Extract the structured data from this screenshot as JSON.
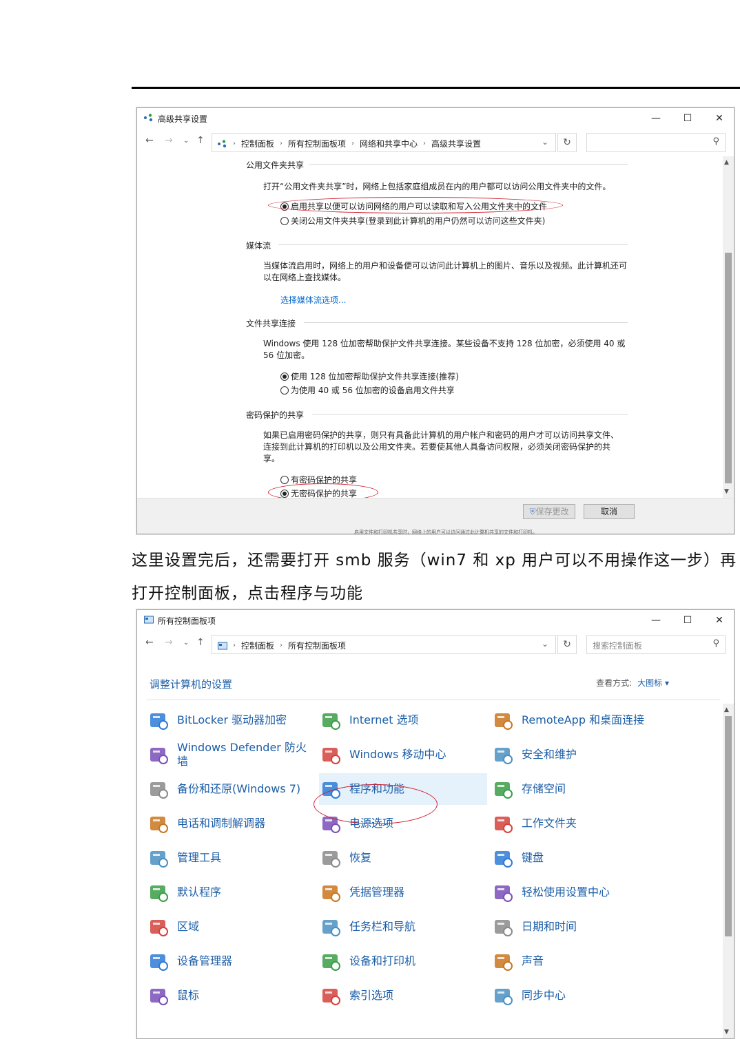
{
  "window1": {
    "title": "高级共享设置",
    "breadcrumbs": [
      "控制面板",
      "所有控制面板项",
      "网络和共享中心",
      "高级共享设置"
    ],
    "sections": {
      "public_folder": {
        "heading": "公用文件夹共享",
        "desc": "打开“公用文件夹共享”时，网络上包括家庭组成员在内的用户都可以访问公用文件夹中的文件。",
        "opt_on": "启用共享以便可以访问网络的用户可以读取和写入公用文件夹中的文件",
        "opt_off": "关闭公用文件夹共享(登录到此计算机的用户仍然可以访问这些文件夹)"
      },
      "media": {
        "heading": "媒体流",
        "desc": "当媒体流启用时，网络上的用户和设备便可以访问此计算机上的图片、音乐以及视频。此计算机还可以在网络上查找媒体。",
        "link": "选择媒体流选项..."
      },
      "file_sharing": {
        "heading": "文件共享连接",
        "desc": "Windows 使用 128 位加密帮助保护文件共享连接。某些设备不支持 128 位加密，必须使用 40 或 56 位加密。",
        "opt_128": "使用 128 位加密帮助保护文件共享连接(推荐)",
        "opt_40": "为使用 40 或 56 位加密的设备启用文件共享"
      },
      "password": {
        "heading": "密码保护的共享",
        "desc": "如果已启用密码保护的共享，则只有具备此计算机的用户帐户和密码的用户才可以访问共享文件、连接到此计算机的打印机以及公用文件夹。若要使其他人具备访问权限，必须关闭密码保护的共享。",
        "opt_on": "有密码保护的共享",
        "opt_off": "无密码保护的共享"
      }
    },
    "save_label": "保存更改",
    "cancel_label": "取消",
    "below_caption": "启用文件和打印机共享时，网络上的用户可以访问通过此计算机共享的文件和打印机。"
  },
  "body_text": {
    "line1": "这里设置完后，还需要打开 smb 服务（win7 和 xp 用户可以不用操作这一步）再",
    "line2": "打开控制面板，点击程序与功能"
  },
  "window2": {
    "title": "所有控制面板项",
    "breadcrumbs": [
      "控制面板",
      "所有控制面板项"
    ],
    "search_placeholder": "搜索控制面板",
    "heading": "调整计算机的设置",
    "view_label": "查看方式:",
    "view_value": "大图标 ▾",
    "items": [
      {
        "label": "BitLocker 驱动器加密",
        "icon": "bitlocker-icon"
      },
      {
        "label": "Internet 选项",
        "icon": "internet-options-icon"
      },
      {
        "label": "RemoteApp 和桌面连接",
        "icon": "remoteapp-icon"
      },
      {
        "label": "Windows Defender 防火墙",
        "icon": "firewall-icon"
      },
      {
        "label": "Windows 移动中心",
        "icon": "mobility-center-icon"
      },
      {
        "label": "安全和维护",
        "icon": "security-maintenance-icon"
      },
      {
        "label": "备份和还原(Windows 7)",
        "icon": "backup-restore-icon"
      },
      {
        "label": "程序和功能",
        "icon": "programs-features-icon"
      },
      {
        "label": "存储空间",
        "icon": "storage-spaces-icon"
      },
      {
        "label": "电话和调制解调器",
        "icon": "phone-modem-icon"
      },
      {
        "label": "电源选项",
        "icon": "power-options-icon"
      },
      {
        "label": "工作文件夹",
        "icon": "work-folders-icon"
      },
      {
        "label": "管理工具",
        "icon": "admin-tools-icon"
      },
      {
        "label": "恢复",
        "icon": "recovery-icon"
      },
      {
        "label": "键盘",
        "icon": "keyboard-icon"
      },
      {
        "label": "默认程序",
        "icon": "default-programs-icon"
      },
      {
        "label": "凭据管理器",
        "icon": "credential-manager-icon"
      },
      {
        "label": "轻松使用设置中心",
        "icon": "ease-of-access-icon"
      },
      {
        "label": "区域",
        "icon": "region-icon"
      },
      {
        "label": "任务栏和导航",
        "icon": "taskbar-icon"
      },
      {
        "label": "日期和时间",
        "icon": "date-time-icon"
      },
      {
        "label": "设备管理器",
        "icon": "device-manager-icon"
      },
      {
        "label": "设备和打印机",
        "icon": "devices-printers-icon"
      },
      {
        "label": "声音",
        "icon": "sound-icon"
      },
      {
        "label": "鼠标",
        "icon": "mouse-icon"
      },
      {
        "label": "索引选项",
        "icon": "indexing-options-icon"
      },
      {
        "label": "同步中心",
        "icon": "sync-center-icon"
      }
    ]
  }
}
